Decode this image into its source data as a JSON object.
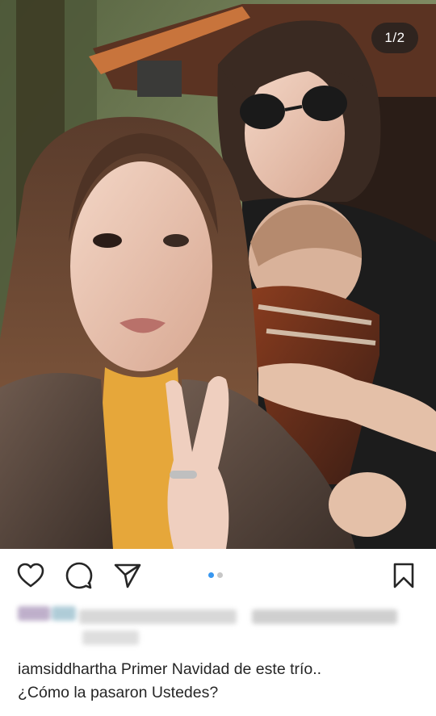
{
  "post": {
    "counter": "1/2",
    "slide_count": 2,
    "active_slide": 1
  },
  "actions": {
    "like_icon": "heart-icon",
    "comment_icon": "comment-icon",
    "share_icon": "paper-plane-icon",
    "save_icon": "bookmark-icon"
  },
  "caption": {
    "username": "iamsiddhartha",
    "text": "Primer Navidad de este trío..",
    "line2": "¿Cómo la pasaron Ustedes?"
  },
  "colors": {
    "text": "#262626",
    "accent_dot": "#3897f0",
    "inactive_dot": "#c7c7c7"
  }
}
